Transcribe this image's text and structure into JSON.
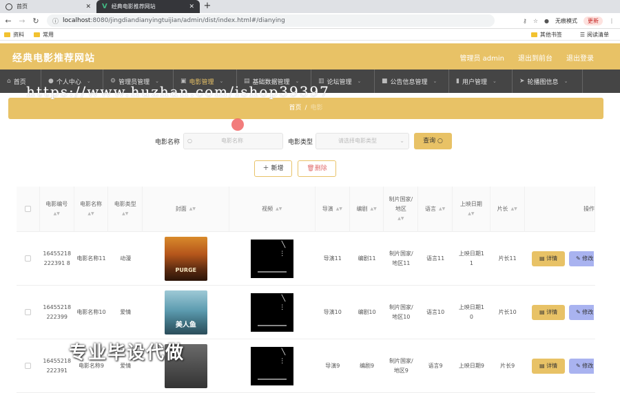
{
  "browser": {
    "tabs": [
      {
        "title": "首页",
        "active": false
      },
      {
        "title": "经典电影推荐网站",
        "active": true
      }
    ],
    "url_host": "localhost",
    "url_path": ":8080/jingdiandianyingtuijian/admin/dist/index.html#/dianying",
    "incognito_label": "无痕模式",
    "update_label": "更新",
    "bookmarks": [
      {
        "label": "资料"
      },
      {
        "label": "常用"
      }
    ],
    "other_bookmarks": "其他书签",
    "reading_list": "阅读清单"
  },
  "header": {
    "brand": "经典电影推荐网站",
    "admin": "管理员 admin",
    "back_front": "退出到前台",
    "logout": "退出登录"
  },
  "menu": [
    {
      "label": "首页",
      "icon": "home-icon"
    },
    {
      "label": "个人中心",
      "icon": "user-icon"
    },
    {
      "label": "管理员管理",
      "icon": "settings-icon"
    },
    {
      "label": "电影管理",
      "icon": "film-icon"
    },
    {
      "label": "基础数据管理",
      "icon": "data-icon"
    },
    {
      "label": "论坛管理",
      "icon": "forum-icon"
    },
    {
      "label": "公告信息管理",
      "icon": "notice-icon"
    },
    {
      "label": "用户管理",
      "icon": "users-icon"
    },
    {
      "label": "轮播图信息",
      "icon": "carousel-icon"
    }
  ],
  "breadcrumb": {
    "home": "首页",
    "sep": "/",
    "current": "电影"
  },
  "search": {
    "name_label": "电影名称",
    "name_placeholder": "电影名称",
    "type_label": "电影类型",
    "type_placeholder": "请选择电影类型",
    "query_label": "查询"
  },
  "actions": {
    "add": "新增",
    "delete": "删除"
  },
  "table": {
    "columns": [
      "电影编号",
      "电影名称",
      "电影类型",
      "封面",
      "视频",
      "导演",
      "编剧",
      "制片国家/地区",
      "语言",
      "上映日期",
      "片长",
      "操作"
    ],
    "rows": [
      {
        "id": "16455218222391 8",
        "name": "电影名称11",
        "type": "动漫",
        "cover": "PURGE",
        "director": "导演11",
        "writer": "编剧11",
        "country": "制片国家/地区11",
        "lang": "语言11",
        "date": "上映日期11",
        "length": "片长11"
      },
      {
        "id": "16455218222399",
        "name": "电影名称10",
        "type": "爱情",
        "cover": "美人鱼",
        "director": "导演10",
        "writer": "编剧10",
        "country": "制片国家/地区10",
        "lang": "语言10",
        "date": "上映日期10",
        "length": "片长10"
      },
      {
        "id": "16455218222391",
        "name": "电影名称9",
        "type": "爱情",
        "cover": "",
        "director": "导演9",
        "writer": "编剧9",
        "country": "制片国家/地区9",
        "lang": "语言9",
        "date": "上映日期9",
        "length": "片长9"
      }
    ],
    "detail_label": "详情",
    "edit_label": "修改"
  },
  "overlay": {
    "url_watermark": "https://www.huzhan.com/ishop39397",
    "caption": "专业毕设代做"
  }
}
